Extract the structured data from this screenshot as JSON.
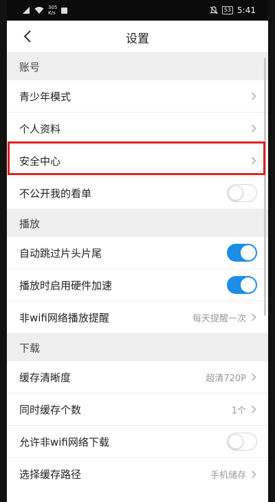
{
  "status_bar": {
    "net_speed_value": "305",
    "net_speed_unit": "K/s",
    "battery": "53",
    "time": "5:41"
  },
  "header": {
    "title": "设置"
  },
  "sections": {
    "account": {
      "title": "账号",
      "teen_mode": "青少年模式",
      "profile": "个人资料",
      "security": "安全中心",
      "private_list": "不公开我的看单",
      "private_list_on": false
    },
    "playback": {
      "title": "播放",
      "skip_intro": "自动跳过片头片尾",
      "skip_intro_on": true,
      "hw_accel": "播放时启用硬件加速",
      "hw_accel_on": true,
      "non_wifi_reminder": "非wifi网络播放提醒",
      "non_wifi_reminder_value": "每天提醒一次"
    },
    "download": {
      "title": "下载",
      "cache_quality": "缓存清晰度",
      "cache_quality_value": "超清720P",
      "concurrent": "同时缓存个数",
      "concurrent_value": "1个",
      "non_wifi_download": "允许非wifi网络下载",
      "non_wifi_download_on": false,
      "cache_path": "选择缓存路径",
      "cache_path_value": "手机储存"
    }
  },
  "colors": {
    "accent": "#1e8de5",
    "highlight": "#e02020"
  }
}
